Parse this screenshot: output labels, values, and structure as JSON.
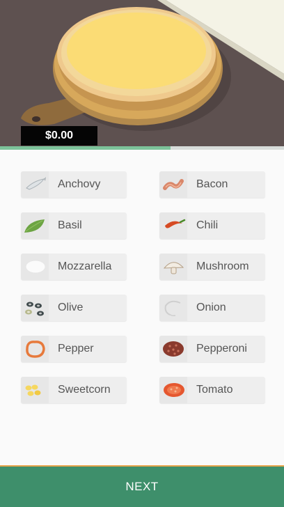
{
  "order": {
    "price": "$0.00",
    "progress_fraction": 0.6
  },
  "toppings": [
    {
      "label": "Anchovy",
      "icon": "anchovy-icon"
    },
    {
      "label": "Bacon",
      "icon": "bacon-icon"
    },
    {
      "label": "Basil",
      "icon": "basil-icon"
    },
    {
      "label": "Chili",
      "icon": "chili-icon"
    },
    {
      "label": "Mozzarella",
      "icon": "mozzarella-icon"
    },
    {
      "label": "Mushroom",
      "icon": "mushroom-icon"
    },
    {
      "label": "Olive",
      "icon": "olive-icon"
    },
    {
      "label": "Onion",
      "icon": "onion-icon"
    },
    {
      "label": "Pepper",
      "icon": "pepper-icon"
    },
    {
      "label": "Pepperoni",
      "icon": "pepperoni-icon"
    },
    {
      "label": "Sweetcorn",
      "icon": "sweetcorn-icon"
    },
    {
      "label": "Tomato",
      "icon": "tomato-icon"
    }
  ],
  "footer": {
    "next_label": "NEXT"
  },
  "colors": {
    "accent": "#3e8f6b",
    "progress": "#7cc39a",
    "footer_border": "#e7a44a"
  }
}
